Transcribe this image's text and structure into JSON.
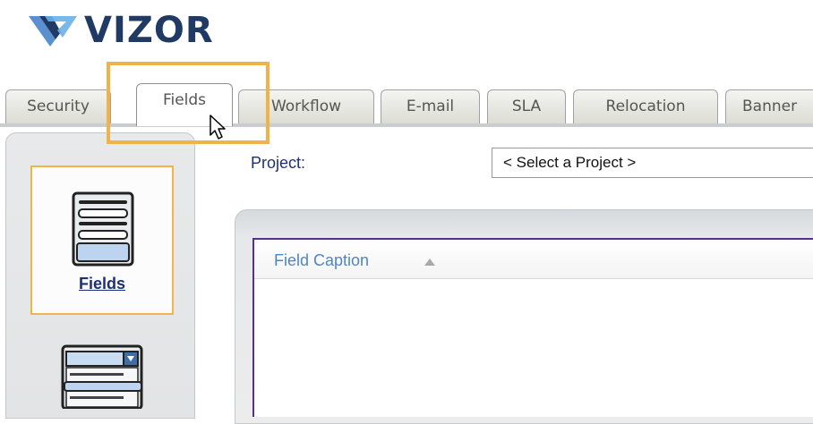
{
  "brand": {
    "name": "VIZOR"
  },
  "tabs": [
    {
      "label": "Security",
      "active": false
    },
    {
      "label": "Fields",
      "active": true
    },
    {
      "label": "Workflow",
      "active": false
    },
    {
      "label": "E-mail",
      "active": false
    },
    {
      "label": "SLA",
      "active": false
    },
    {
      "label": "Relocation",
      "active": false
    },
    {
      "label": "Banner",
      "active": false
    }
  ],
  "sidebar": {
    "items": [
      {
        "label": "Fields",
        "icon": "fields-form-icon",
        "selected": true
      },
      {
        "label": "",
        "icon": "dropdown-list-icon",
        "selected": false
      }
    ]
  },
  "project": {
    "label": "Project:",
    "select_value": "< Select a Project >"
  },
  "grid": {
    "columns": [
      {
        "label": "Field Caption",
        "sort": "ascending"
      }
    ]
  },
  "colors": {
    "brand": "#203A63",
    "highlight": "#F2B24A",
    "grid_border": "#5A2E91",
    "column_header": "#4F86C2",
    "label_text": "#1D2F7A"
  }
}
